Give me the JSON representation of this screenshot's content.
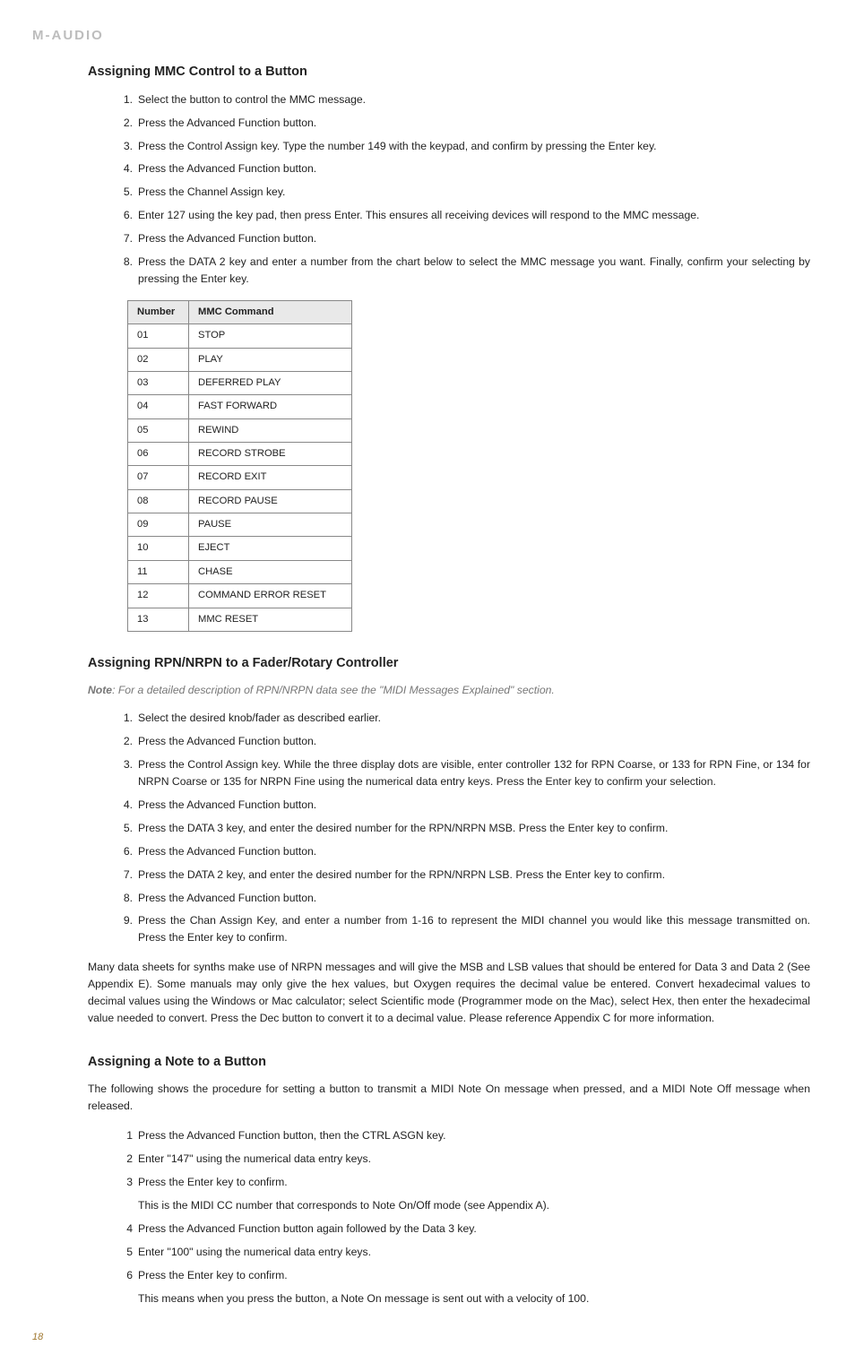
{
  "brand": "M-AUDIO",
  "page_number": "18",
  "section1": {
    "heading": "Assigning MMC Control to a Button",
    "steps": [
      "Select the button to control the MMC message.",
      "Press the Advanced Function button.",
      "Press the Control Assign key. Type the number 149 with the keypad, and confirm by pressing the Enter key.",
      "Press the Advanced Function button.",
      "Press the Channel Assign key.",
      "Enter 127 using the key pad, then press Enter.  This ensures all receiving devices will respond to the MMC message.",
      "Press the Advanced Function button.",
      "Press the DATA 2 key and enter a number from the chart below to select the MMC message you want.  Finally, confirm your selecting by pressing the Enter key."
    ],
    "table": {
      "headers": [
        "Number",
        "MMC Command"
      ],
      "rows": [
        [
          "01",
          "STOP"
        ],
        [
          "02",
          "PLAY"
        ],
        [
          "03",
          "DEFERRED PLAY"
        ],
        [
          "04",
          "FAST FORWARD"
        ],
        [
          "05",
          "REWIND"
        ],
        [
          "06",
          "RECORD STROBE"
        ],
        [
          "07",
          "RECORD EXIT"
        ],
        [
          "08",
          "RECORD PAUSE"
        ],
        [
          "09",
          "PAUSE"
        ],
        [
          "10",
          "EJECT"
        ],
        [
          "11",
          "CHASE"
        ],
        [
          "12",
          "COMMAND ERROR RESET"
        ],
        [
          "13",
          "MMC RESET"
        ]
      ]
    }
  },
  "section2": {
    "heading": "Assigning RPN/NRPN to a Fader/Rotary Controller",
    "note_label": "Note",
    "note_text": ": For a detailed description of RPN/NRPN data see the \"MIDI Messages Explained\" section.",
    "steps": [
      "Select the desired knob/fader as described earlier.",
      "Press the Advanced Function button.",
      "Press the Control Assign key. While the three display dots are visible, enter controller 132 for RPN Coarse, or 133 for RPN Fine, or 134 for NRPN Coarse or 135 for NRPN Fine using the numerical data entry keys.  Press the Enter key to confirm your selection.",
      "Press the Advanced Function button.",
      "Press the DATA 3 key, and enter the desired number for the RPN/NRPN MSB. Press the Enter key to confirm.",
      "Press the Advanced Function button.",
      "Press the DATA 2 key, and enter the desired number for the RPN/NRPN LSB. Press the Enter key to confirm.",
      "Press the Advanced Function button.",
      "Press the Chan Assign Key, and enter a number from 1-16 to represent the MIDI channel you would like this message transmitted on.  Press the Enter key to confirm."
    ],
    "paragraph": "Many data sheets for synths make use of NRPN messages and will give the MSB and LSB values that should be entered for Data 3 and Data 2 (See Appendix E). Some manuals may only give the hex values, but Oxygen requires the decimal value be entered. Convert hexadecimal values to decimal values using the Windows or Mac calculator; select Scientific mode (Programmer mode on the Mac), select Hex, then enter the hexadecimal value needed to convert. Press the Dec button to convert it to a decimal value. Please reference Appendix C for more information."
  },
  "section3": {
    "heading": "Assigning a Note to a Button",
    "intro": "The following shows the procedure for setting a button to transmit a MIDI Note On message when pressed, and a MIDI Note Off message when released.",
    "steps": [
      "Press the Advanced Function button, then the CTRL ASGN key.",
      "Enter \"147\" using the numerical data entry keys.",
      "Press the Enter key to confirm.",
      "This is the MIDI CC number that corresponds to Note On/Off mode (see Appendix A).",
      "Press the Advanced Function button again followed by the Data 3 key.",
      "Enter \"100\" using the numerical data entry keys.",
      "Press the Enter key to confirm.",
      "This means when you press the button, a Note On message is sent out with a velocity of 100."
    ],
    "step_numbers": [
      "1",
      "2",
      "3",
      "",
      "4",
      "5",
      "6",
      ""
    ]
  }
}
